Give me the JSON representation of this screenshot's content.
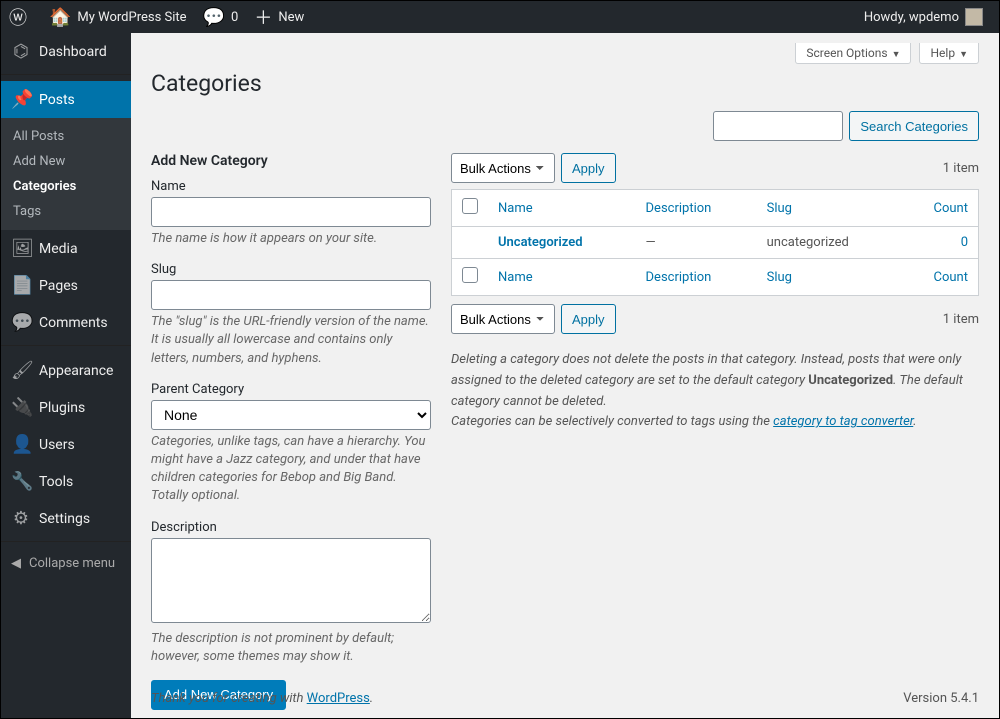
{
  "adminbar": {
    "site_title": "My WordPress Site",
    "comments": "0",
    "new": "New",
    "howdy": "Howdy, wpdemo"
  },
  "sidebar": {
    "items": [
      {
        "icon": "⌬",
        "label": "Dashboard"
      },
      {
        "icon": "📌",
        "label": "Posts",
        "current": true
      },
      {
        "icon": "🖼",
        "label": "Media"
      },
      {
        "icon": "📄",
        "label": "Pages"
      },
      {
        "icon": "💬",
        "label": "Comments"
      },
      {
        "icon": "🖌",
        "label": "Appearance"
      },
      {
        "icon": "🔌",
        "label": "Plugins"
      },
      {
        "icon": "👤",
        "label": "Users"
      },
      {
        "icon": "🔧",
        "label": "Tools"
      },
      {
        "icon": "⚙",
        "label": "Settings"
      }
    ],
    "submenu": [
      {
        "label": "All Posts"
      },
      {
        "label": "Add New"
      },
      {
        "label": "Categories",
        "current": true
      },
      {
        "label": "Tags"
      }
    ],
    "collapse": "Collapse menu"
  },
  "meta": {
    "screen_options": "Screen Options",
    "help": "Help"
  },
  "page_title": "Categories",
  "search": {
    "button": "Search Categories"
  },
  "form": {
    "heading": "Add New Category",
    "name_label": "Name",
    "name_hint": "The name is how it appears on your site.",
    "slug_label": "Slug",
    "slug_hint": "The \"slug\" is the URL-friendly version of the name. It is usually all lowercase and contains only letters, numbers, and hyphens.",
    "parent_label": "Parent Category",
    "parent_option": "None",
    "parent_hint": "Categories, unlike tags, can have a hierarchy. You might have a Jazz category, and under that have children categories for Bebop and Big Band. Totally optional.",
    "desc_label": "Description",
    "desc_hint": "The description is not prominent by default; however, some themes may show it.",
    "submit": "Add New Category"
  },
  "table": {
    "bulk": "Bulk Actions",
    "apply": "Apply",
    "count_label": "1 item",
    "cols": {
      "name": "Name",
      "description": "Description",
      "slug": "Slug",
      "count": "Count"
    },
    "rows": [
      {
        "name": "Uncategorized",
        "description": "—",
        "slug": "uncategorized",
        "count": "0"
      }
    ]
  },
  "note": {
    "line1a": "Deleting a category does not delete the posts in that category. Instead, posts that were only assigned to the deleted category are set to the default category ",
    "line1b": "Uncategorized",
    "line1c": ". The default category cannot be deleted.",
    "line2a": "Categories can be selectively converted to tags using the ",
    "line2link": "category to tag converter",
    "line2b": "."
  },
  "footer": {
    "thanks_a": "Thank you for creating with ",
    "wp": "WordPress",
    "thanks_b": ".",
    "version": "Version 5.4.1"
  }
}
